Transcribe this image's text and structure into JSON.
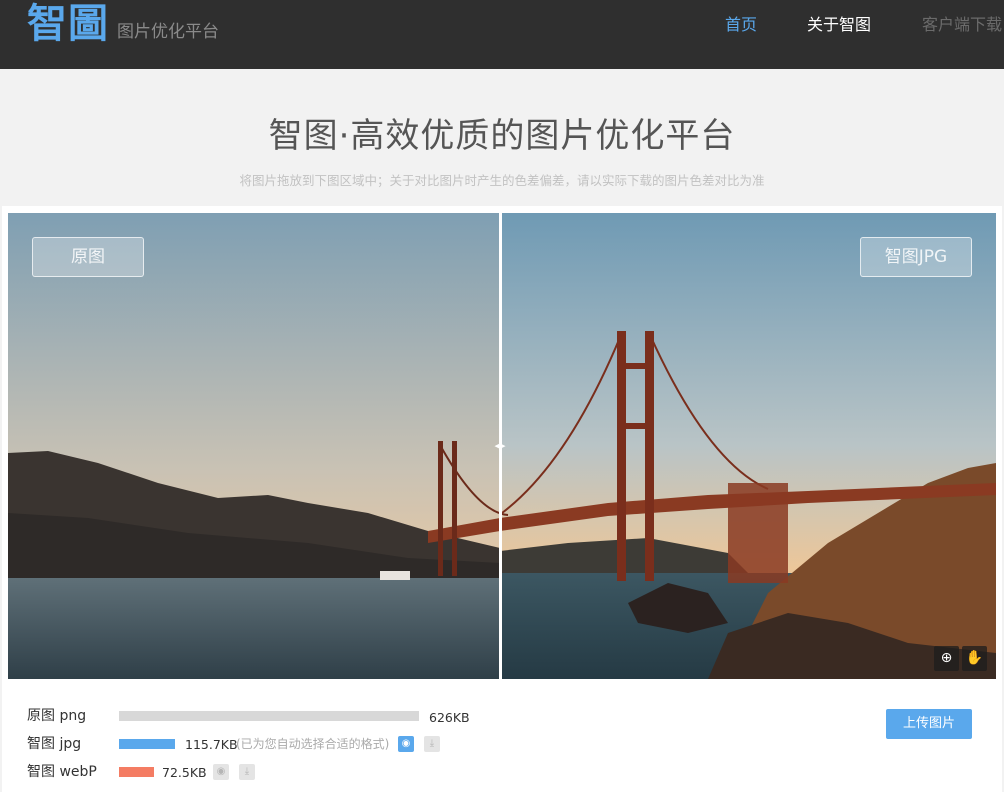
{
  "header": {
    "logo": "智圖",
    "tagline": "图片优化平台",
    "nav": [
      "首页",
      "关于智图",
      "客户端下载"
    ]
  },
  "hero": {
    "title": "智图·高效优质的图片优化平台",
    "note": "将图片拖放到下图区域中；关于对比图片时产生的色差偏差，请以实际下载的图片色差对比为准"
  },
  "compare": {
    "left_label": "原图",
    "right_label": "智图JPG",
    "handle_glyph": "◂▸",
    "zoom_glyph": "⊕",
    "hand_glyph": "✋"
  },
  "results": {
    "rows": [
      {
        "label": "原图 png",
        "size": "626KB",
        "bar_fraction": 1.0
      },
      {
        "label": "智图 jpg",
        "size": "115.7KB",
        "bar_fraction": 0.185
      },
      {
        "label": "智图 webP",
        "size": "72.5KB",
        "bar_fraction": 0.116
      }
    ],
    "auto_note": "(已为您自动选择合适的格式)",
    "upload_label": "上传图片",
    "colors": {
      "png": "#d8d8d8",
      "jpg": "#5aa8ec",
      "webp": "#f47c63",
      "accent": "#5aa8ec"
    }
  }
}
